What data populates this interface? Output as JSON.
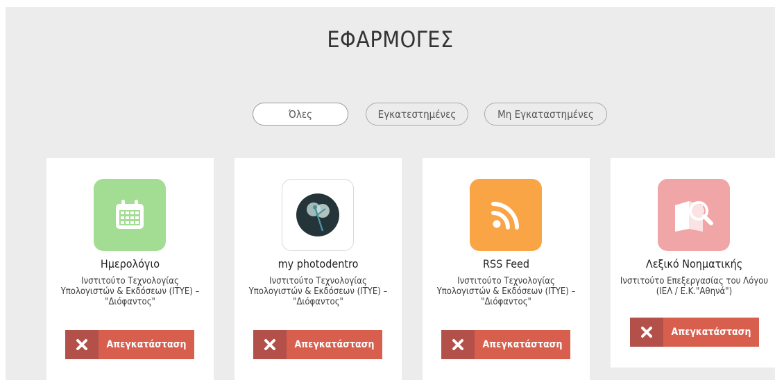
{
  "page": {
    "title": "ΕΦΑΡΜΟΓΕΣ"
  },
  "filters": [
    {
      "label": "Όλες",
      "active": true
    },
    {
      "label": "Εγκατεστημένες",
      "active": false
    },
    {
      "label": "Μη Εγκαταστημένες",
      "active": false
    }
  ],
  "apps": [
    {
      "name": "Ημερολόγιο",
      "vendor": "Ινστιτούτο Τεχνολογίας Υπολογιστών & Εκδόσεων (ΙΤΥΕ) – \"Διόφαντος\"",
      "icon": "calendar-icon",
      "icon_color": "#a3dc93",
      "action_label": "Απεγκατάσταση"
    },
    {
      "name": "my photodentro",
      "vendor": "Ινστιτούτο Τεχνολογίας Υπολογιστών & Εκδόσεων (ΙΤΥΕ) – \"Διόφαντος\"",
      "icon": "dandelion-icon",
      "icon_color": "#ffffff",
      "action_label": "Απεγκατάσταση"
    },
    {
      "name": "RSS Feed",
      "vendor": "Ινστιτούτο Τεχνολογίας Υπολογιστών & Εκδόσεων (ΙΤΥΕ) – \"Διόφαντος\"",
      "icon": "rss-icon",
      "icon_color": "#f9a545",
      "action_label": "Απεγκατάσταση"
    },
    {
      "name": "Λεξικό Νοηματικής",
      "vendor": "Ινστιτούτο Επεξεργασίας του Λόγου (ΙΕΛ / Ε.Κ.\"Αθηνά\")",
      "icon": "book-magnifier-icon",
      "icon_color": "#f0a5a6",
      "action_label": "Απεγκατάσταση"
    }
  ],
  "colors": {
    "background": "#ececec",
    "uninstall_button": "#d85f4d",
    "uninstall_icon_box": "#b3504a"
  }
}
